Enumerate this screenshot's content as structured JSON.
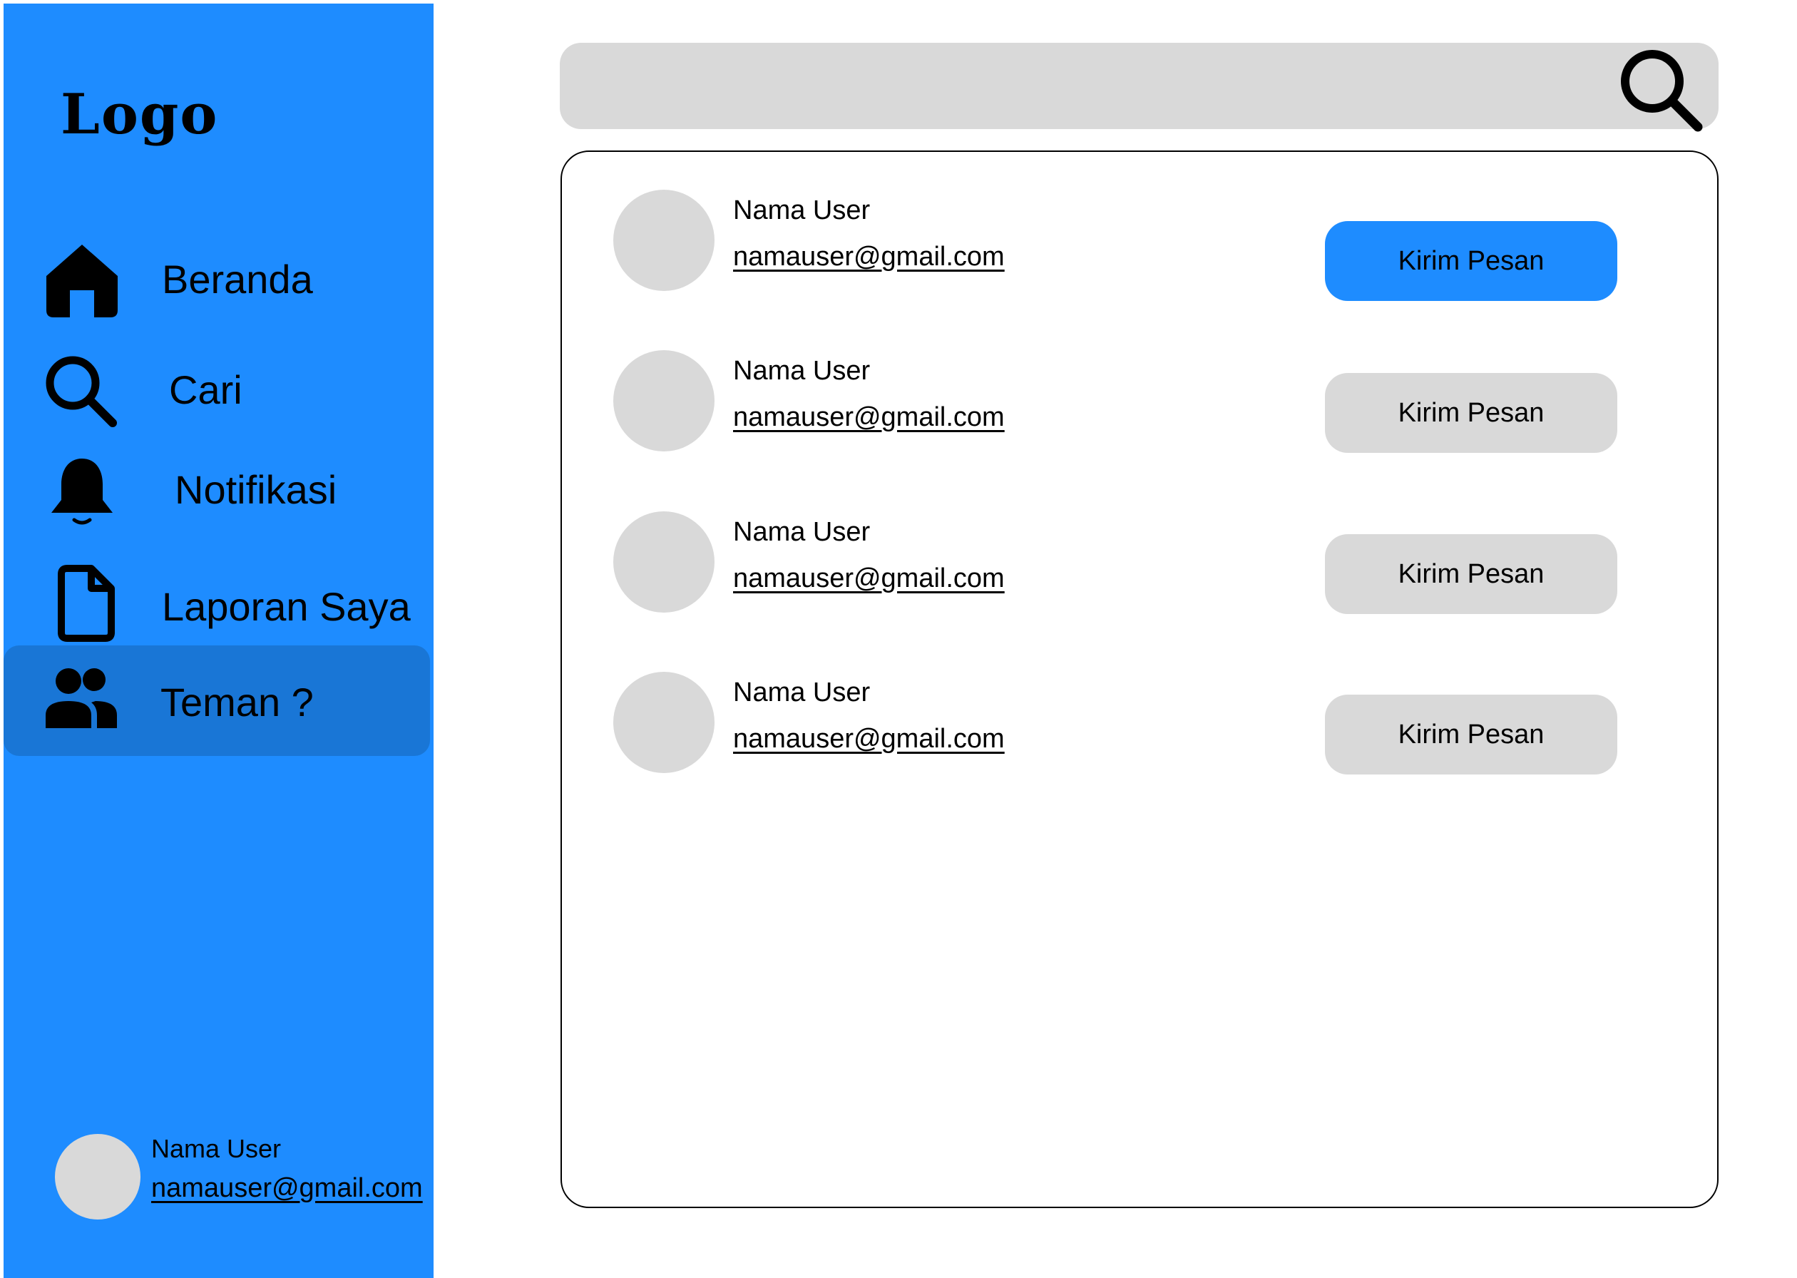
{
  "colors": {
    "sidebar": "#1e8cff",
    "sidebar_active": "#1976d6",
    "placeholder_gray": "#d9d9d9",
    "primary_button": "#1e8cff"
  },
  "sidebar": {
    "logo": "Logo",
    "items": [
      {
        "label": "Beranda",
        "icon": "home-icon"
      },
      {
        "label": "Cari",
        "icon": "search-icon"
      },
      {
        "label": "Notifikasi",
        "icon": "bell-icon"
      },
      {
        "label": "Laporan Saya",
        "icon": "document-icon"
      },
      {
        "label": "Teman ?",
        "icon": "users-icon",
        "active": true
      }
    ],
    "profile": {
      "name": "Nama User",
      "email": "namauser@gmail.com"
    }
  },
  "search": {
    "placeholder": "",
    "icon": "search-icon"
  },
  "friends": [
    {
      "name": "Nama User",
      "email": "namauser@gmail.com",
      "button": "Kirim Pesan",
      "highlighted": true
    },
    {
      "name": "Nama User",
      "email": "namauser@gmail.com",
      "button": "Kirim Pesan",
      "highlighted": false
    },
    {
      "name": "Nama User",
      "email": "namauser@gmail.com",
      "button": "Kirim Pesan",
      "highlighted": false
    },
    {
      "name": "Nama User",
      "email": "namauser@gmail.com",
      "button": "Kirim Pesan",
      "highlighted": false
    }
  ]
}
